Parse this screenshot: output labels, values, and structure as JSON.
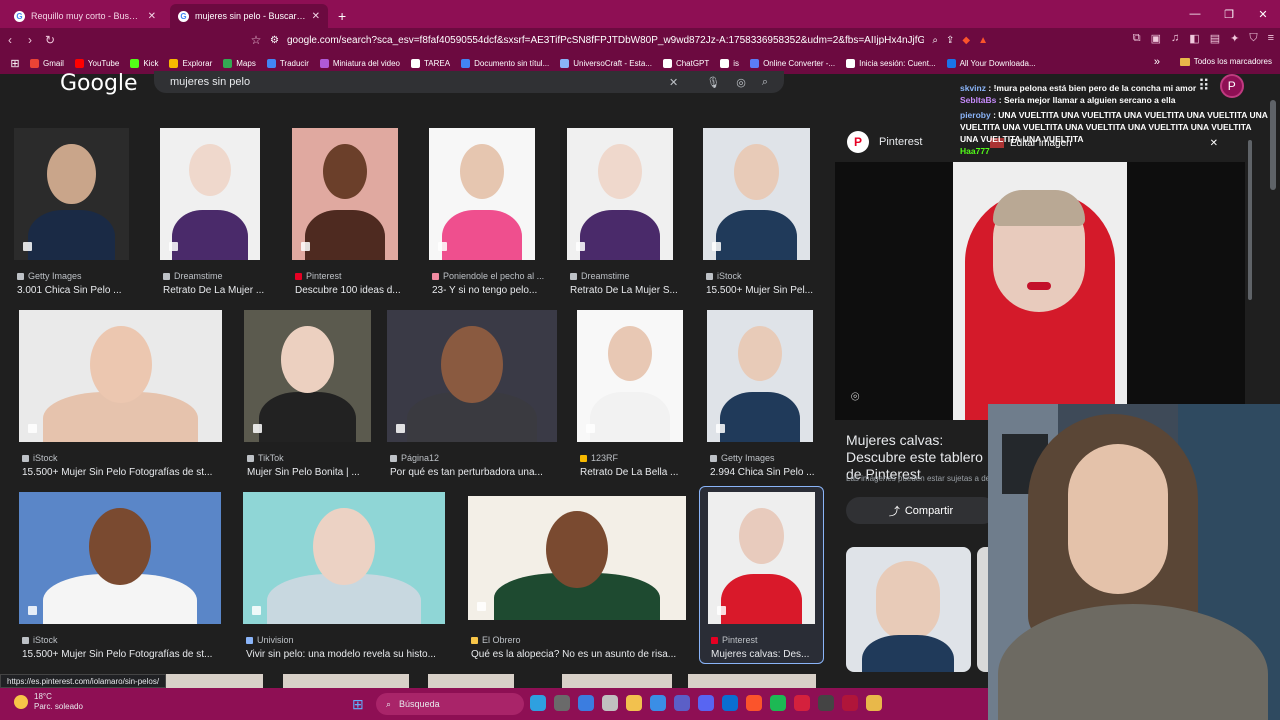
{
  "browser": {
    "tabs": [
      {
        "title": "Requillo muy corto - Buscar con Google",
        "active": false
      },
      {
        "title": "mujeres sin pelo - Buscar con Google",
        "active": true
      }
    ],
    "url": "google.com/search?sca_esv=f8faf40590554dcf&sxsrf=AE3TifPcSN8fFPJTDbW80P_w9wd872Jz-A:1758336958352&udm=2&fbs=AIIjpHx4nJjfGoj...",
    "bookmarks": [
      "Gmail",
      "YouTube",
      "Kick",
      "Explorar",
      "Maps",
      "Traducir",
      "Miniatura del video",
      "TAREA",
      "Documento sin títul...",
      "UniversoCraft - Esta...",
      "ChatGPT",
      "is",
      "Online Converter -...",
      "Inicia sesión: Cuent...",
      "All Your Downloada..."
    ],
    "bookmark_colors": [
      "#ea4335",
      "#ff0000",
      "#53fc18",
      "#f7b900",
      "#34a853",
      "#4285f4",
      "#b05ad8",
      "#ffffff",
      "#4285f4",
      "#8ab4f8",
      "#ffffff",
      "#ffffff",
      "#5b7cf7",
      "#ffffff",
      "#1a73e8"
    ],
    "all_bookmarks": "Todos los marcadores"
  },
  "google": {
    "logo": "Google",
    "query": "mujeres sin pelo",
    "avatar_letter": "P"
  },
  "results": [
    {
      "source": "Getty Images",
      "title": "3.001 Chica Sin Pelo ...",
      "bg": "#2b2b2b",
      "skin": "#c9a58a",
      "cloth": "#1a2a45",
      "src_color": "#bdc1c6"
    },
    {
      "source": "Dreamstime",
      "title": "Retrato De La Mujer ...",
      "bg": "#f0f0f0",
      "skin": "#efd8cc",
      "cloth": "#4a2a6a",
      "src_color": "#bdc1c6"
    },
    {
      "source": "Pinterest",
      "title": "Descubre 100 ideas d...",
      "bg": "#e0a9a0",
      "skin": "#6b3f2a",
      "cloth": "#4e2a20",
      "src_color": "#e60023"
    },
    {
      "source": "Poniendole el pecho al ...",
      "title": "23- Y si no tengo pelo...",
      "bg": "#f7f7f7",
      "skin": "#e6c6b0",
      "cloth": "#ef4f8e",
      "src_color": "#f08aa0"
    },
    {
      "source": "Dreamstime",
      "title": "Retrato De La Mujer S...",
      "bg": "#f0f0f0",
      "skin": "#efd8cc",
      "cloth": "#4a2a6a",
      "src_color": "#bdc1c6"
    },
    {
      "source": "iStock",
      "title": "15.500+ Mujer Sin Pel...",
      "bg": "#dfe3e8",
      "skin": "#e8cbb8",
      "cloth": "#203a5a",
      "src_color": "#bdc1c6"
    },
    {
      "source": "iStock",
      "title": "15.500+ Mujer Sin Pelo Fotografías de st...",
      "bg": "#eaeaea",
      "skin": "#ecc7b0",
      "cloth": "#e6c3ad",
      "src_color": "#bdc1c6"
    },
    {
      "source": "TikTok",
      "title": "Mujer Sin Pelo Bonita | ...",
      "bg": "#5b5a4e",
      "skin": "#ecd0c0",
      "cloth": "#222222",
      "src_color": "#bdc1c6"
    },
    {
      "source": "Página12",
      "title": "Por qué es tan perturbadora una...",
      "bg": "#3a3a46",
      "skin": "#8a5a40",
      "cloth": "#3a3a40",
      "src_color": "#bdc1c6"
    },
    {
      "source": "123RF",
      "title": "Retrato De La Bella ...",
      "bg": "#f8f8f8",
      "skin": "#e8c8b4",
      "cloth": "#f2f2f2",
      "src_color": "#f7b900"
    },
    {
      "source": "Getty Images",
      "title": "2.994 Chica Sin Pelo ...",
      "bg": "#dfe3e8",
      "skin": "#e8cbb8",
      "cloth": "#203a5a",
      "src_color": "#bdc1c6"
    },
    {
      "source": "iStock",
      "title": "15.500+ Mujer Sin Pelo Fotografías de st...",
      "bg": "#5a86c8",
      "skin": "#7a4a30",
      "cloth": "#f5f5f5",
      "src_color": "#bdc1c6"
    },
    {
      "source": "Univision",
      "title": "Vivir sin pelo: una modelo revela su histo...",
      "bg": "#8fd6d6",
      "skin": "#ecd2c4",
      "cloth": "#c8d8e0",
      "src_color": "#8ab4f8"
    },
    {
      "source": "El Obrero",
      "title": "Qué es la alopecia? No es un asunto de risa...",
      "bg": "#f3efe7",
      "skin": "#7a4a30",
      "cloth": "#1e4a30",
      "src_color": "#f7c548"
    },
    {
      "source": "Pinterest",
      "title": "Mujeres calvas: Des...",
      "bg": "#eeeeee",
      "skin": "#e8cbbd",
      "cloth": "#d9192a",
      "src_color": "#e60023"
    }
  ],
  "panel": {
    "site": "Pinterest",
    "title": "Mujeres calvas: Descubre este tablero de Pinterest",
    "subtitle": "Las imágenes pueden estar sujetas a derechos",
    "share": "Compartir",
    "editor_button": "Editar imagen"
  },
  "chat": [
    {
      "user": "skvinz",
      "text": "!mura pelona está bien pero de la concha mi amor"
    },
    {
      "user": "SebltaBs",
      "text": "Seria mejor llamar a alguien sercano a ella"
    },
    {
      "user": "pieroby",
      "text": "UNA VUELTITA UNA VUELTITA UNA VUELTITA UNA VUELTITA UNA VUELTITA UNA VUELTITA UNA VUELTITA UNA VUELTITA UNA VUELTITA UNA VUELTITA UNA VUELTITA"
    },
    {
      "user": "Haa777",
      "text": ""
    }
  ],
  "status_url": "https://es.pinterest.com/iolamaro/sin-pelos/",
  "taskbar": {
    "temp": "18°C",
    "weather": "Parc. soleado",
    "search": "Búsqueda"
  }
}
